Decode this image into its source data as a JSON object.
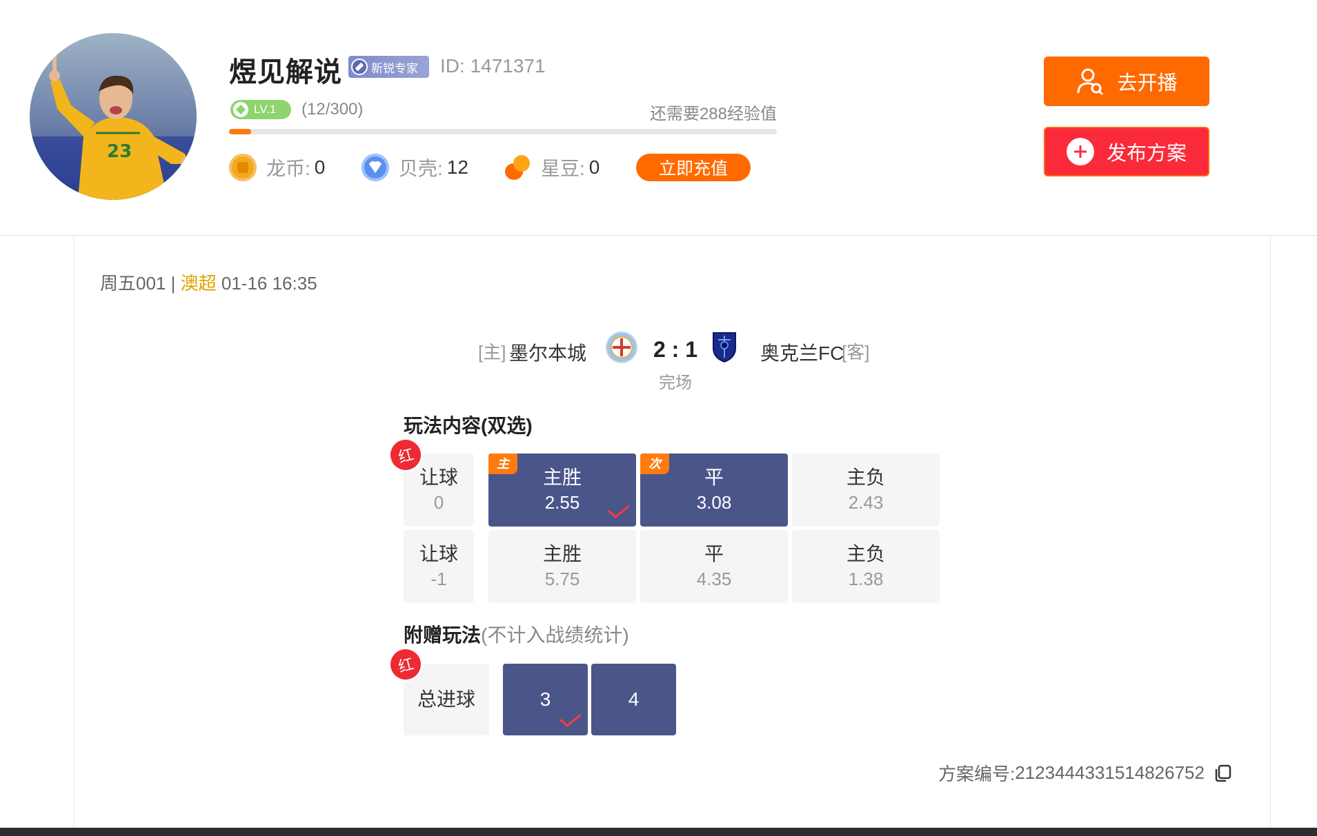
{
  "profile": {
    "name": "煜见解说",
    "expert_badge": "新锐专家",
    "id_text": "ID: 1471371",
    "level_label": "LV.1",
    "level_progress_text": "(12/300)",
    "level_progress_fraction": 0.04,
    "exp_needed_text": "还需要288经验值"
  },
  "wallet": {
    "long_coin_label": "龙币:",
    "long_coin_value": "0",
    "shell_label": "贝壳:",
    "shell_value": "12",
    "star_bean_label": "星豆:",
    "star_bean_value": "0",
    "recharge_label": "立即充值"
  },
  "actions": {
    "live_label": "去开播",
    "publish_label": "发布方案"
  },
  "match": {
    "week_code": "周五001",
    "separator": "|",
    "league": "澳超",
    "datetime": "01-16 16:35",
    "home_tag": "[主]",
    "home_team": "墨尔本城",
    "score": "2 : 1",
    "status": "完场",
    "away_team": "奥克兰FC",
    "away_tag": "[客]"
  },
  "main_play": {
    "title": "玩法内容",
    "subtitle": "(双选)",
    "result_badge": "红",
    "rows": [
      {
        "handicap_label": "让球",
        "handicap_value": "0",
        "options": [
          {
            "label": "主胜",
            "odds": "2.55",
            "selected": true,
            "tag": "主",
            "correct": true
          },
          {
            "label": "平",
            "odds": "3.08",
            "selected": true,
            "tag": "次",
            "correct": false
          },
          {
            "label": "主负",
            "odds": "2.43",
            "selected": false,
            "tag": "",
            "correct": false
          }
        ]
      },
      {
        "handicap_label": "让球",
        "handicap_value": "-1",
        "options": [
          {
            "label": "主胜",
            "odds": "5.75",
            "selected": false,
            "tag": "",
            "correct": false
          },
          {
            "label": "平",
            "odds": "4.35",
            "selected": false,
            "tag": "",
            "correct": false
          },
          {
            "label": "主负",
            "odds": "1.38",
            "selected": false,
            "tag": "",
            "correct": false
          }
        ]
      }
    ]
  },
  "bonus_play": {
    "title": "附赠玩法",
    "note": "(不计入战绩统计)",
    "result_badge": "红",
    "label": "总进球",
    "options": [
      {
        "label": "3",
        "selected": true,
        "correct": true
      },
      {
        "label": "4",
        "selected": true,
        "correct": false
      }
    ]
  },
  "plan": {
    "number_label": "方案编号:",
    "number_value": "2123444331514826752"
  },
  "colors": {
    "accent_orange": "#ff6a00",
    "publish_red": "#fa2a3a",
    "selected_navy": "#4a5589",
    "league_gold": "#e0a200",
    "badge_red": "#ee2a34"
  }
}
